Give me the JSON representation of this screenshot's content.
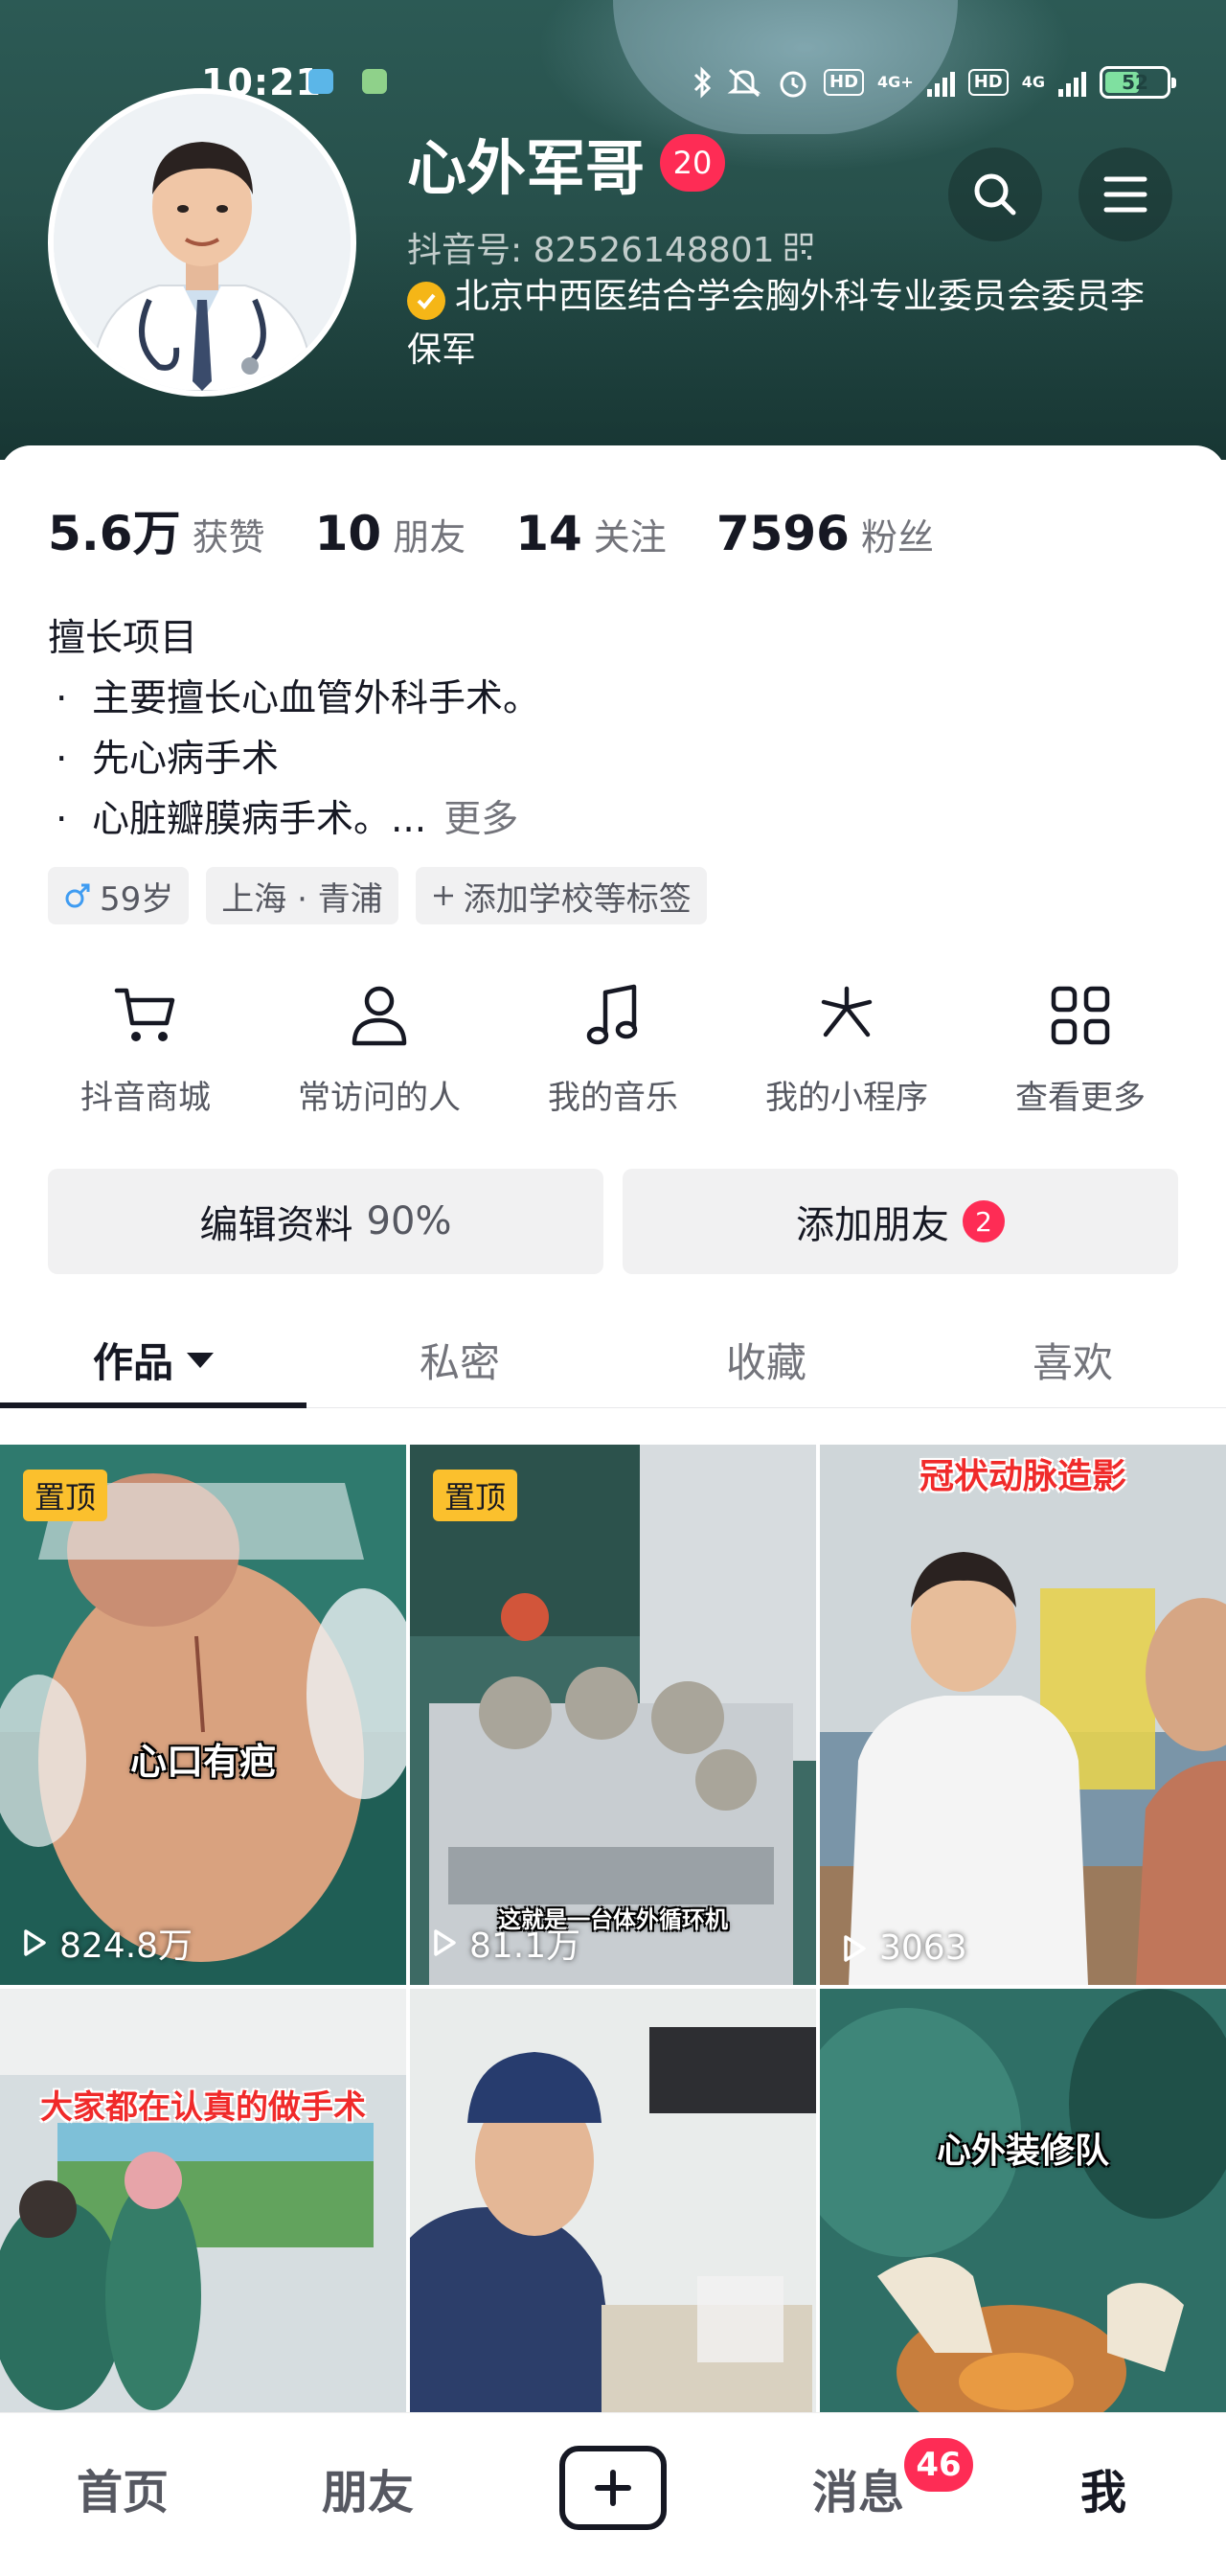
{
  "status_bar": {
    "time": "10:21",
    "battery": "52",
    "network_labels": [
      "4G+",
      "4G"
    ],
    "hd_label": "HD"
  },
  "profile": {
    "nickname": "心外军哥",
    "level": "20",
    "douyin_id": "抖音号: 82526148801",
    "verification": "北京中西医结合学会胸外科专业委员会委员李保军"
  },
  "stats": [
    {
      "value": "5.6万",
      "label": "获赞"
    },
    {
      "value": "10",
      "label": "朋友"
    },
    {
      "value": "14",
      "label": "关注"
    },
    {
      "value": "7596",
      "label": "粉丝"
    }
  ],
  "bio": {
    "heading": "擅长项目",
    "bullet": "·",
    "lines": [
      "主要擅长心血管外科手术。",
      "先心病手术",
      "心脏瓣膜病手术。..."
    ],
    "more": "更多"
  },
  "tags": [
    {
      "icon": "male-icon",
      "label": "59岁"
    },
    {
      "icon": "",
      "label": "上海 · 青浦"
    },
    {
      "icon": "plus-icon",
      "label": "添加学校等标签"
    }
  ],
  "tools": [
    {
      "icon": "cart-icon",
      "label": "抖音商城"
    },
    {
      "icon": "person-icon",
      "label": "常访问的人"
    },
    {
      "icon": "music-note-icon",
      "label": "我的音乐"
    },
    {
      "icon": "mini-program-icon",
      "label": "我的小程序"
    },
    {
      "icon": "grid-icon",
      "label": "查看更多"
    }
  ],
  "actions": {
    "edit_label": "编辑资料",
    "edit_pct": "90%",
    "add_friend_label": "添加朋友",
    "add_friend_badge": "2"
  },
  "tabs": [
    "作品",
    "私密",
    "收藏",
    "喜欢"
  ],
  "videos": [
    {
      "pinned": "置顶",
      "caption": "心口有疤",
      "plays": "824.8万"
    },
    {
      "pinned": "置顶",
      "caption": "这就是一台体外循环机",
      "plays": "81.1万"
    },
    {
      "pinned": "",
      "caption": "冠状动脉造影",
      "plays": "3063"
    },
    {
      "pinned": "",
      "caption": "大家都在认真的做手术",
      "plays": ""
    },
    {
      "pinned": "",
      "caption": "",
      "plays": ""
    },
    {
      "pinned": "",
      "caption": "心外装修队",
      "plays": ""
    }
  ],
  "bottom_nav": [
    {
      "label": "首页"
    },
    {
      "label": "朋友"
    },
    {
      "label": ""
    },
    {
      "label": "消息",
      "badge": "46"
    },
    {
      "label": "我"
    }
  ],
  "colors": {
    "accent": "#fe2c55",
    "header_bg": "#27504b",
    "pin_bg": "#fbc02d",
    "verify_badge": "#f5b617"
  }
}
